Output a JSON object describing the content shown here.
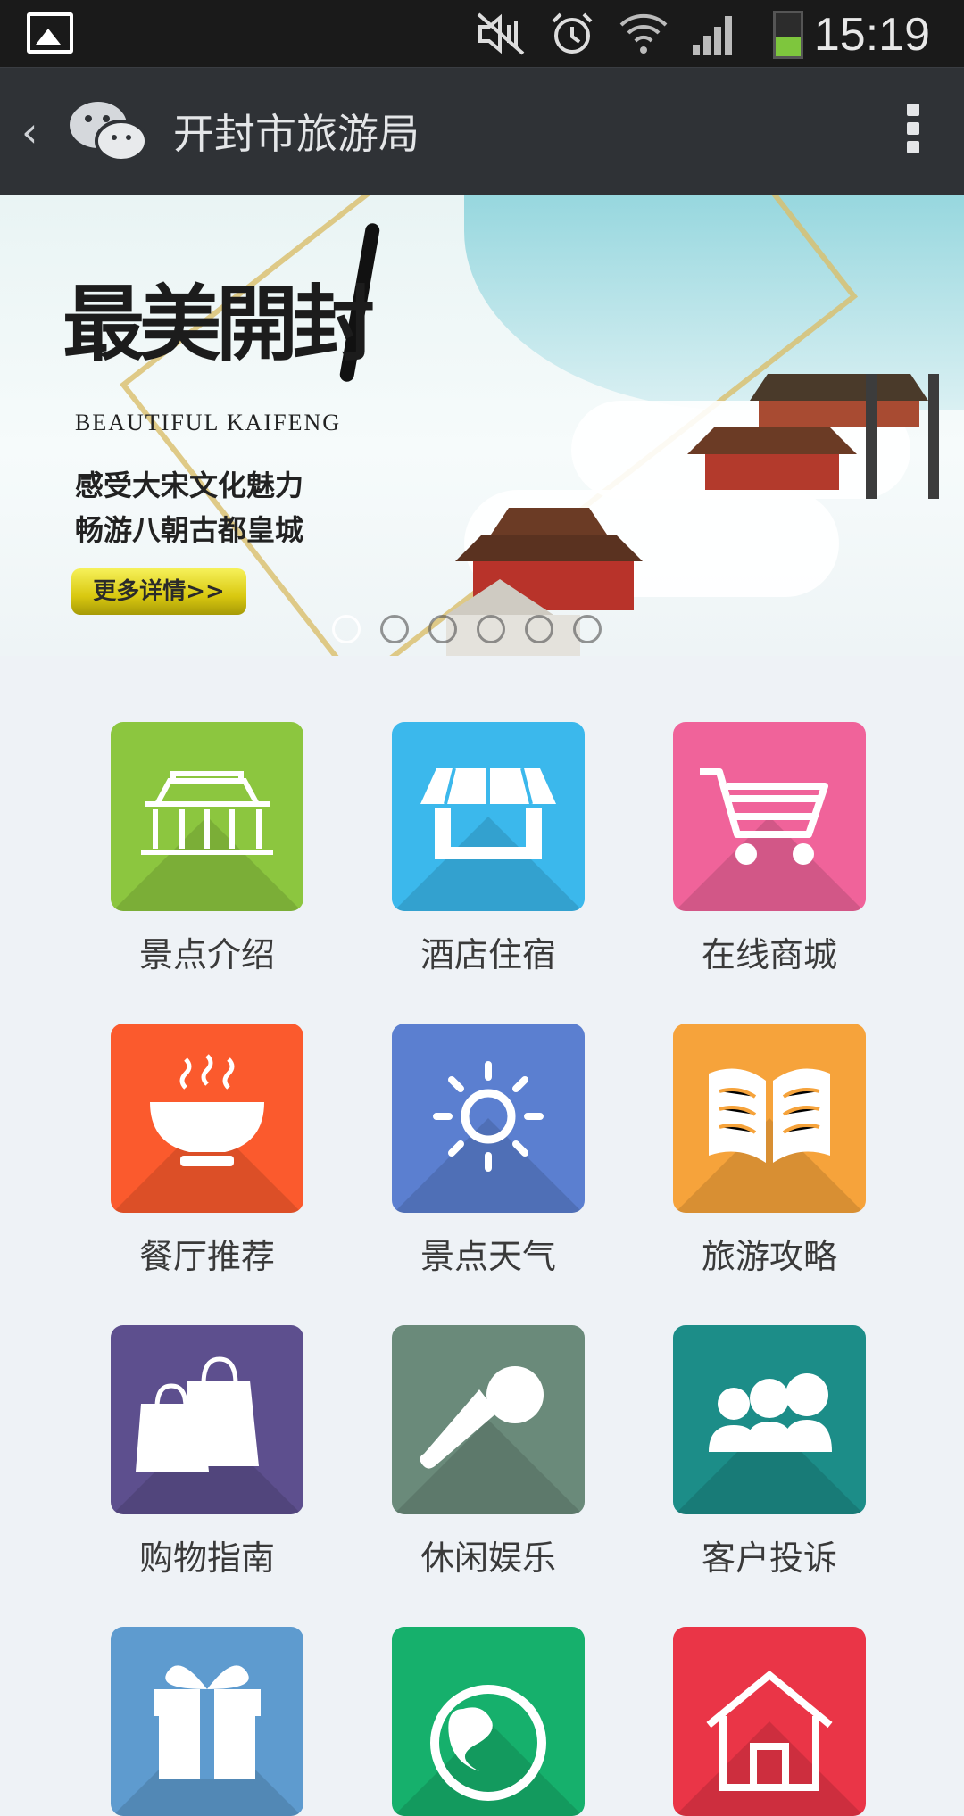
{
  "status_bar": {
    "time": "15:19",
    "battery_level": 0.45,
    "icons": [
      "gallery-icon",
      "mute-icon",
      "alarm-icon",
      "wifi-icon",
      "signal-icon",
      "battery-icon"
    ]
  },
  "title_bar": {
    "back_glyph": "‹",
    "title": "开封市旅游局"
  },
  "banner": {
    "logo_text": "最美開封",
    "english": "BEAUTIFUL KAIFENG",
    "line1": "感受大宋文化魅力",
    "line2": "畅游八朝古都皇城",
    "button": "更多详情>>",
    "slide_count": 6,
    "active_slide": 1
  },
  "menu": [
    {
      "label": "景点介绍",
      "color": "#8cc63f",
      "icon": "temple-icon"
    },
    {
      "label": "酒店住宿",
      "color": "#3bb8ec",
      "icon": "store-icon"
    },
    {
      "label": "在线商城",
      "color": "#f0639a",
      "icon": "cart-icon"
    },
    {
      "label": "餐厅推荐",
      "color": "#fb5a2d",
      "icon": "bowl-icon"
    },
    {
      "label": "景点天气",
      "color": "#5b7fd0",
      "icon": "sun-icon"
    },
    {
      "label": "旅游攻略",
      "color": "#f6a33b",
      "icon": "book-icon"
    },
    {
      "label": "购物指南",
      "color": "#5d4f8e",
      "icon": "shopping-bags-icon"
    },
    {
      "label": "休闲娱乐",
      "color": "#6a8a7a",
      "icon": "microphone-icon"
    },
    {
      "label": "客户投诉",
      "color": "#1c8d88",
      "icon": "group-icon"
    },
    {
      "label": "",
      "color": "#5e9bcf",
      "icon": "gift-icon"
    },
    {
      "label": "",
      "color": "#16b06c",
      "icon": "globe-icon"
    },
    {
      "label": "",
      "color": "#ea3547",
      "icon": "house-icon"
    }
  ]
}
